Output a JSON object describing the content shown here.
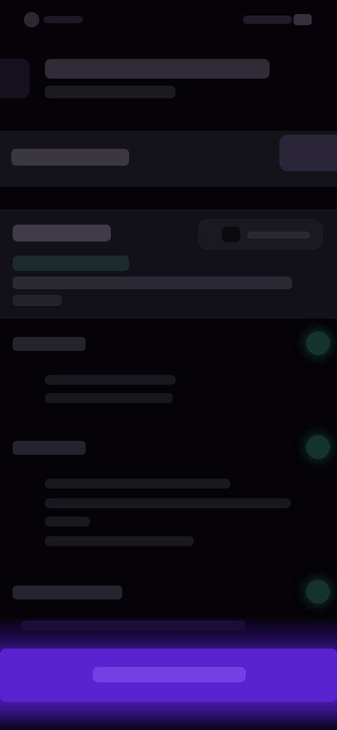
{
  "status_bar": {
    "icons": [
      "app-icon",
      "battery-icon"
    ]
  },
  "header": {
    "title": "",
    "subtitle": ""
  },
  "banner": {
    "text": "",
    "button_label": ""
  },
  "score_card": {
    "title": "",
    "pill_text": "",
    "highlight": "",
    "description": ""
  },
  "sections": [
    {
      "title": "",
      "status_icon": "check-icon",
      "items": [
        "",
        ""
      ]
    },
    {
      "title": "",
      "status_icon": "check-icon",
      "items": [
        "",
        "",
        ""
      ]
    },
    {
      "title": "",
      "status_icon": "check-icon",
      "items": [
        ""
      ]
    }
  ],
  "cta": {
    "label": "",
    "accent": "#5b23cf"
  },
  "colors": {
    "background": "#050307",
    "card": "#131118",
    "success_glow": "#14332c",
    "cta_purple": "#5b23cf"
  }
}
